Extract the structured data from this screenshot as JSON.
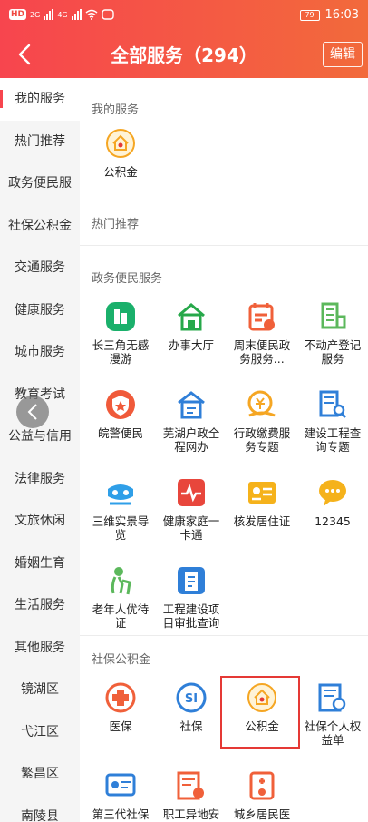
{
  "status": {
    "hd": "HD",
    "net1": "2G",
    "net2": "4G",
    "battery": "79",
    "time": "16:03"
  },
  "header": {
    "title": "全部服务（294）",
    "edit": "编辑"
  },
  "colors": {
    "brand": "#f7454e",
    "brand2": "#f26a3b",
    "highlight": "#e53935"
  },
  "sidebar": {
    "items": [
      {
        "label": "我的服务"
      },
      {
        "label": "热门推荐"
      },
      {
        "label": "政务便民服"
      },
      {
        "label": "社保公积金"
      },
      {
        "label": "交通服务"
      },
      {
        "label": "健康服务"
      },
      {
        "label": "城市服务"
      },
      {
        "label": "教育考试"
      },
      {
        "label": "公益与信用"
      },
      {
        "label": "法律服务"
      },
      {
        "label": "文旅休闲"
      },
      {
        "label": "婚姻生育"
      },
      {
        "label": "生活服务"
      },
      {
        "label": "其他服务"
      },
      {
        "label": "镜湖区"
      },
      {
        "label": "弋江区"
      },
      {
        "label": "繁昌区"
      },
      {
        "label": "南陵县"
      }
    ]
  },
  "sections": {
    "mine": {
      "title": "我的服务",
      "items": [
        {
          "label": "公积金",
          "icon": "housing-fund-icon"
        }
      ]
    },
    "hot": {
      "title": "热门推荐"
    },
    "gov": {
      "title": "政务便民服务",
      "items": [
        {
          "label": "长三角无感\n漫游",
          "icon": "building-green-icon"
        },
        {
          "label": "办事大厅",
          "icon": "house-green-icon"
        },
        {
          "label": "周末便民政\n务服务...",
          "icon": "calendar-icon"
        },
        {
          "label": "不动产登记\n服务",
          "icon": "property-icon"
        },
        {
          "label": "皖警便民",
          "icon": "police-badge-icon"
        },
        {
          "label": "芜湖户政全\n程网办",
          "icon": "household-icon"
        },
        {
          "label": "行政缴费服\n务专题",
          "icon": "payment-icon"
        },
        {
          "label": "建设工程查\n询专题",
          "icon": "construction-search-icon"
        },
        {
          "label": "三维实景导\n览",
          "icon": "vr-icon"
        },
        {
          "label": "健康家庭一\n卡通",
          "icon": "health-card-icon"
        },
        {
          "label": "核发居住证",
          "icon": "residence-card-icon"
        },
        {
          "label": "12345",
          "icon": "hotline-icon"
        },
        {
          "label": "老年人优待\n证",
          "icon": "elderly-icon"
        },
        {
          "label": "工程建设项\n目审批查询",
          "icon": "project-approval-icon"
        }
      ]
    },
    "social": {
      "title": "社保公积金",
      "items": [
        {
          "label": "医保",
          "icon": "medical-insurance-icon"
        },
        {
          "label": "社保",
          "icon": "social-security-icon"
        },
        {
          "label": "公积金",
          "icon": "housing-fund-icon"
        },
        {
          "label": "社保个人权\n益单",
          "icon": "rights-statement-icon"
        },
        {
          "label": "第三代社保\n卡申请",
          "icon": "social-card-icon"
        },
        {
          "label": "职工异地安\n置回基",
          "icon": "relocation-icon"
        },
        {
          "label": "城乡居民医\n保登记缴费",
          "icon": "resident-medical-icon"
        }
      ]
    }
  }
}
